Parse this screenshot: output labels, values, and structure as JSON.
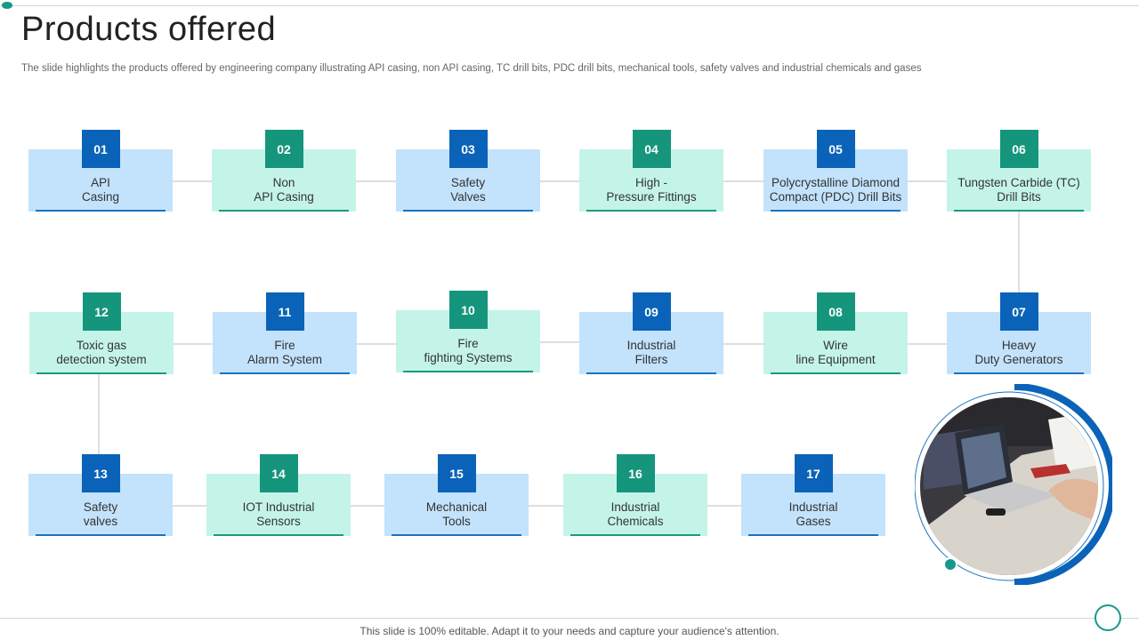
{
  "page": {
    "title": "Products offered",
    "subtitle": "The slide highlights the products offered by engineering company illustrating API casing, non API casing, TC drill bits, PDC drill bits, mechanical tools, safety valves and industrial chemicals and gases",
    "footer": "This slide is 100% editable. Adapt it to your needs and capture your audience's attention."
  },
  "colors": {
    "blue_card": "#c3e2fb",
    "mint_card": "#c4f4e8",
    "blue_badge": "#0a63b8",
    "mint_badge": "#16957d",
    "accent": "#17998a"
  },
  "products": [
    {
      "num": "01",
      "line1": "API",
      "line2": "Casing",
      "color": "blue"
    },
    {
      "num": "02",
      "line1": "Non",
      "line2": "API Casing",
      "color": "mint"
    },
    {
      "num": "03",
      "line1": "Safety",
      "line2": "Valves",
      "color": "blue"
    },
    {
      "num": "04",
      "line1": "High -",
      "line2": "Pressure Fittings",
      "color": "mint"
    },
    {
      "num": "05",
      "line1": "Polycrystalline Diamond",
      "line2": "Compact (PDC) Drill Bits",
      "color": "blue"
    },
    {
      "num": "06",
      "line1": "Tungsten Carbide (TC)",
      "line2": "Drill Bits",
      "color": "mint"
    },
    {
      "num": "07",
      "line1": "Heavy",
      "line2": "Duty Generators",
      "color": "blue"
    },
    {
      "num": "08",
      "line1": "Wire",
      "line2": "line Equipment",
      "color": "mint"
    },
    {
      "num": "09",
      "line1": "Industrial",
      "line2": "Filters",
      "color": "blue"
    },
    {
      "num": "10",
      "line1": "Fire",
      "line2": "fighting Systems",
      "color": "mint"
    },
    {
      "num": "11",
      "line1": "Fire",
      "line2": "Alarm System",
      "color": "blue"
    },
    {
      "num": "12",
      "line1": "Toxic gas",
      "line2": "detection system",
      "color": "mint"
    },
    {
      "num": "13",
      "line1": "Safety",
      "line2": "valves",
      "color": "blue"
    },
    {
      "num": "14",
      "line1": "IOT Industrial",
      "line2": "Sensors",
      "color": "mint"
    },
    {
      "num": "15",
      "line1": "Mechanical",
      "line2": "Tools",
      "color": "blue"
    },
    {
      "num": "16",
      "line1": "Industrial",
      "line2": "Chemicals",
      "color": "mint"
    },
    {
      "num": "17",
      "line1": "Industrial",
      "line2": "Gases",
      "color": "blue"
    }
  ]
}
